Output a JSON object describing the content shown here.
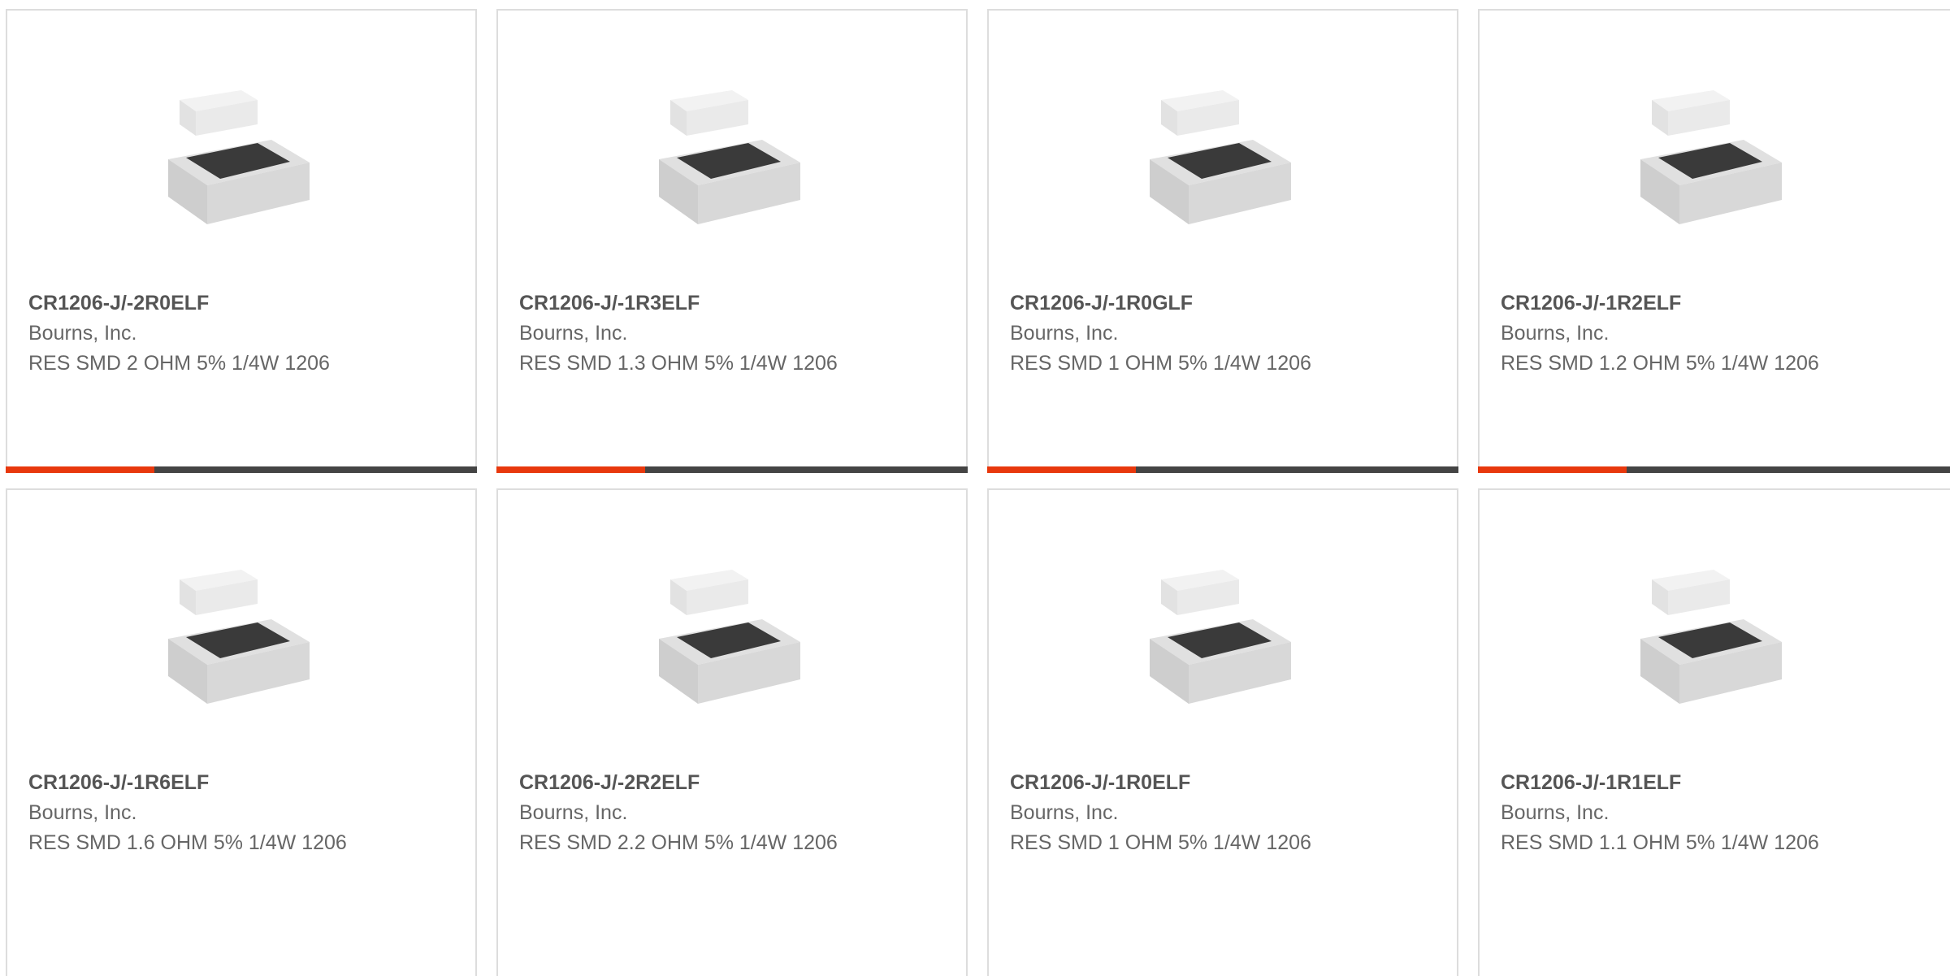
{
  "colors": {
    "accent": "#e8380d",
    "bar": "#444444"
  },
  "products": [
    {
      "part": "CR1206-J/-2R0ELF",
      "manufacturer": "Bourns, Inc.",
      "description": "RES SMD 2 OHM 5% 1/4W 1206",
      "image_icon": "chip-resistor-icon"
    },
    {
      "part": "CR1206-J/-1R3ELF",
      "manufacturer": "Bourns, Inc.",
      "description": "RES SMD 1.3 OHM 5% 1/4W 1206",
      "image_icon": "chip-resistor-icon"
    },
    {
      "part": "CR1206-J/-1R0GLF",
      "manufacturer": "Bourns, Inc.",
      "description": "RES SMD 1 OHM 5% 1/4W 1206",
      "image_icon": "chip-resistor-icon"
    },
    {
      "part": "CR1206-J/-1R2ELF",
      "manufacturer": "Bourns, Inc.",
      "description": "RES SMD 1.2 OHM 5% 1/4W 1206",
      "image_icon": "chip-resistor-icon"
    },
    {
      "part": "CR1206-J/-1R6ELF",
      "manufacturer": "Bourns, Inc.",
      "description": "RES SMD 1.6 OHM 5% 1/4W 1206",
      "image_icon": "chip-resistor-icon"
    },
    {
      "part": "CR1206-J/-2R2ELF",
      "manufacturer": "Bourns, Inc.",
      "description": "RES SMD 2.2 OHM 5% 1/4W 1206",
      "image_icon": "chip-resistor-icon"
    },
    {
      "part": "CR1206-J/-1R0ELF",
      "manufacturer": "Bourns, Inc.",
      "description": "RES SMD 1 OHM 5% 1/4W 1206",
      "image_icon": "chip-resistor-icon"
    },
    {
      "part": "CR1206-J/-1R1ELF",
      "manufacturer": "Bourns, Inc.",
      "description": "RES SMD 1.1 OHM 5% 1/4W 1206",
      "image_icon": "chip-resistor-icon"
    }
  ]
}
